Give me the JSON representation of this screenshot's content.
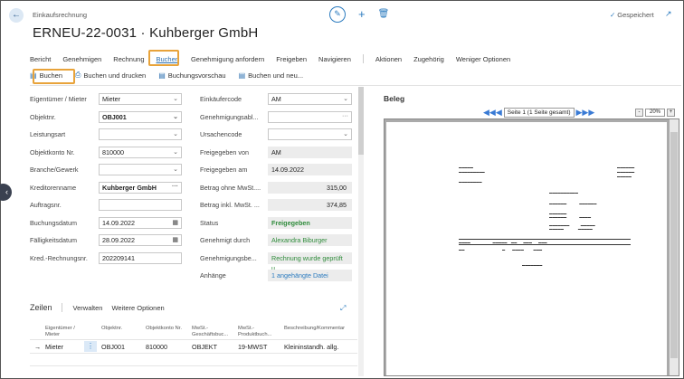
{
  "header": {
    "page_type": "Einkaufsrechnung",
    "title": "ERNEU-22-0031 · Kuhberger GmbH",
    "saved_label": "Gespeichert"
  },
  "menu": {
    "items": [
      "Bericht",
      "Genehmigen",
      "Rechnung",
      "Buchen",
      "Genehmigung anfordern",
      "Freigeben",
      "Navigieren",
      "Aktionen",
      "Zugehörig",
      "Weniger Optionen"
    ],
    "active": "Buchen"
  },
  "actions": {
    "items": [
      {
        "label": "Buchen",
        "icon": "post-icon"
      },
      {
        "label": "Buchen und drucken",
        "icon": "print-icon"
      },
      {
        "label": "Buchungsvorschau",
        "icon": "preview-icon"
      },
      {
        "label": "Buchen und neu...",
        "icon": "post-new-icon"
      }
    ]
  },
  "form": {
    "left": [
      {
        "label": "Eigentümer / Mieter",
        "value": "Mieter",
        "type": "select"
      },
      {
        "label": "Objektnr.",
        "value": "OBJ001",
        "type": "select",
        "bold": true
      },
      {
        "label": "Leistungsart",
        "value": "",
        "type": "select"
      },
      {
        "label": "Objektkonto Nr.",
        "value": "810000",
        "type": "select"
      },
      {
        "label": "Branche/Gewerk",
        "value": "",
        "type": "select"
      },
      {
        "label": "Kreditorenname",
        "value": "Kuhberger GmbH",
        "type": "lookup",
        "bold": true
      },
      {
        "label": "Auftragsnr.",
        "value": "",
        "type": "text"
      },
      {
        "label": "Buchungsdatum",
        "value": "14.09.2022",
        "type": "date"
      },
      {
        "label": "Fälligkeitsdatum",
        "value": "28.09.2022",
        "type": "date"
      },
      {
        "label": "Kred.-Rechnungsnr.",
        "value": "202209141",
        "type": "text"
      }
    ],
    "right": [
      {
        "label": "Einkäufercode",
        "value": "AM",
        "type": "select"
      },
      {
        "label": "Genehmigungsabl...",
        "value": "",
        "type": "lookup"
      },
      {
        "label": "Ursachencode",
        "value": "",
        "type": "select"
      },
      {
        "label": "Freigegeben von",
        "value": "AM",
        "type": "readonly"
      },
      {
        "label": "Freigegeben am",
        "value": "14.09.2022",
        "type": "readonly"
      },
      {
        "label": "Betrag ohne MwSt....",
        "value": "315,00",
        "type": "readonly-num"
      },
      {
        "label": "Betrag inkl. MwSt. ...",
        "value": "374,85",
        "type": "readonly-num"
      },
      {
        "label": "Status",
        "value": "Freigegeben",
        "type": "status"
      },
      {
        "label": "Genehmigt durch",
        "value": "Alexandra Biburger",
        "type": "status-norm"
      },
      {
        "label": "Genehmigungsbe...",
        "value": "Rechnung wurde geprüft u...",
        "type": "status-norm"
      },
      {
        "label": "Anhänge",
        "value": "1 angehängte Datei",
        "type": "link"
      }
    ]
  },
  "lines": {
    "title": "Zeilen",
    "actions": [
      "Verwalten",
      "Weitere Optionen"
    ],
    "columns": [
      "Eigentümer / Mieter",
      "Objektnr.",
      "Objektkonto Nr.",
      "MwSt.-Geschäftsbuc...",
      "MwSt.-Produktbuch...",
      "Beschreibung/Kommentar"
    ],
    "rows": [
      [
        "Mieter",
        "OBJ001",
        "810000",
        "OBJEKT",
        "19-MWST",
        "Kleininstandh. allg."
      ]
    ]
  },
  "preview": {
    "title": "Beleg",
    "page_label": "Seite 1 (1 Seite gesamt)",
    "zoom": "20%"
  },
  "colors": {
    "accent": "#2b7bbf",
    "highlight": "#e8a33a",
    "status_green": "#2e8b3a"
  }
}
